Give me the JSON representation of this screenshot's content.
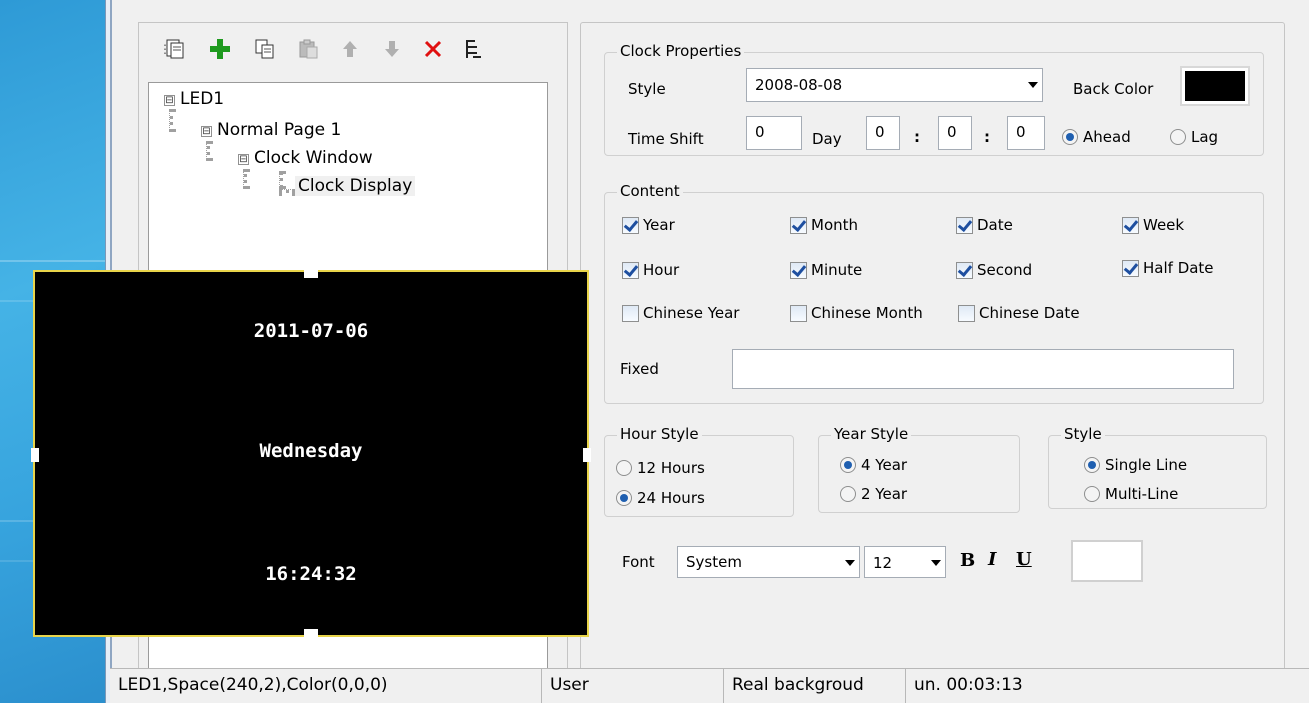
{
  "toolbar": {
    "icons": [
      "new-page-icon",
      "add-icon",
      "copy-icon",
      "paste-icon",
      "move-up-icon",
      "move-down-icon",
      "delete-icon",
      "tree-icon"
    ]
  },
  "tree": {
    "nodes": [
      {
        "label": "LED1",
        "expander": "⊟"
      },
      {
        "label": "Normal Page 1",
        "expander": "⊟"
      },
      {
        "label": "Clock Window",
        "expander": "⊟"
      },
      {
        "label": "Clock Display",
        "expander": ""
      }
    ]
  },
  "clock_properties": {
    "title": "Clock Properties",
    "style_label": "Style",
    "style_value": "2008-08-08",
    "back_color_label": "Back Color",
    "back_color": "#000000",
    "time_shift_label": "Time Shift",
    "time_shift_value": "0",
    "day_label": "Day",
    "hours": "0",
    "minutes": "0",
    "seconds": "0",
    "colon": ":",
    "ahead_label": "Ahead",
    "lag_label": "Lag",
    "ahead_selected": true
  },
  "content": {
    "title": "Content",
    "items": [
      {
        "label": "Year",
        "checked": true
      },
      {
        "label": "Month",
        "checked": true
      },
      {
        "label": "Date",
        "checked": true
      },
      {
        "label": "Week",
        "checked": true
      },
      {
        "label": "Hour",
        "checked": true
      },
      {
        "label": "Minute",
        "checked": true
      },
      {
        "label": "Second",
        "checked": true
      },
      {
        "label": "Half Date",
        "checked": true
      },
      {
        "label": "Chinese Year",
        "checked": false
      },
      {
        "label": "Chinese Month",
        "checked": false
      },
      {
        "label": "Chinese Date",
        "checked": false
      }
    ],
    "fixed_label": "Fixed",
    "fixed_value": ""
  },
  "hour_style": {
    "title": "Hour Style",
    "opt1": "12 Hours",
    "opt2": "24 Hours",
    "selected": 2
  },
  "year_style": {
    "title": "Year Style",
    "opt1": "4 Year",
    "opt2": "2 Year",
    "selected": 1
  },
  "line_style": {
    "title": "Style",
    "opt1": "Single Line",
    "opt2": "Multi-Line",
    "selected": 1
  },
  "font": {
    "label": "Font",
    "family": "System",
    "size": "12",
    "bold": "B",
    "italic": "I",
    "underline": "U",
    "color": "#ffffff"
  },
  "preview": {
    "date": "2011-07-06",
    "weekday": "Wednesday",
    "time": "16:24:32"
  },
  "status": {
    "led": "LED1,Space(240,2),Color(0,0,0)",
    "user": "User",
    "background": "Real backgroud",
    "timer": "un. 00:03:13"
  },
  "colors": {
    "preview_border": "#e8d44a",
    "add_icon": "#1e9a1e",
    "delete_icon": "#e01010"
  }
}
